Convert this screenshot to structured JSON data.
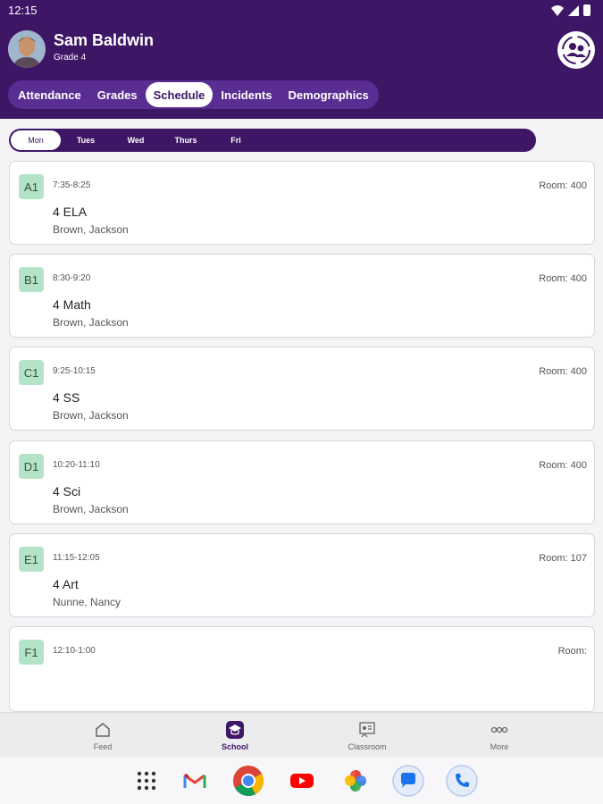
{
  "status_bar": {
    "time": "12:15"
  },
  "student": {
    "name": "Sam Baldwin",
    "grade": "Grade 4"
  },
  "tabs": [
    {
      "label": "Attendance",
      "active": false
    },
    {
      "label": "Grades",
      "active": false
    },
    {
      "label": "Schedule",
      "active": true
    },
    {
      "label": "Incidents",
      "active": false
    },
    {
      "label": "Demographics",
      "active": false
    }
  ],
  "days": [
    {
      "label": "Mon",
      "active": true
    },
    {
      "label": "Tues",
      "active": false
    },
    {
      "label": "Wed",
      "active": false
    },
    {
      "label": "Thurs",
      "active": false
    },
    {
      "label": "Fri",
      "active": false
    }
  ],
  "schedule": [
    {
      "period": "A1",
      "time": "7:35-8:25",
      "room": "Room: 400",
      "course": "4 ELA",
      "teacher": "Brown, Jackson"
    },
    {
      "period": "B1",
      "time": "8:30-9:20",
      "room": "Room: 400",
      "course": "4 Math",
      "teacher": "Brown, Jackson"
    },
    {
      "period": "C1",
      "time": "9:25-10:15",
      "room": "Room: 400",
      "course": "4 SS",
      "teacher": "Brown, Jackson"
    },
    {
      "period": "D1",
      "time": "10:20-11:10",
      "room": "Room: 400",
      "course": "4 Sci",
      "teacher": "Brown, Jackson"
    },
    {
      "period": "E1",
      "time": "11:15-12:05",
      "room": "Room: 107",
      "course": "4 Art",
      "teacher": "Nunne, Nancy"
    },
    {
      "period": "F1",
      "time": "12:10-1:00",
      "room": "Room:",
      "course": "",
      "teacher": ""
    }
  ],
  "bottom_nav": [
    {
      "label": "Feed",
      "icon": "house-icon",
      "active": false
    },
    {
      "label": "School",
      "icon": "graduation-cap-icon",
      "active": true
    },
    {
      "label": "Classroom",
      "icon": "classroom-icon",
      "active": false
    },
    {
      "label": "More",
      "icon": "more-icon",
      "active": false
    }
  ],
  "dock": [
    "app-drawer-icon",
    "gmail-icon",
    "chrome-icon",
    "youtube-icon",
    "photos-icon",
    "messages-icon",
    "phone-icon"
  ],
  "colors": {
    "header": "#3e1666",
    "tab_bar": "#5a2d92",
    "badge": "#b5e3c7"
  }
}
